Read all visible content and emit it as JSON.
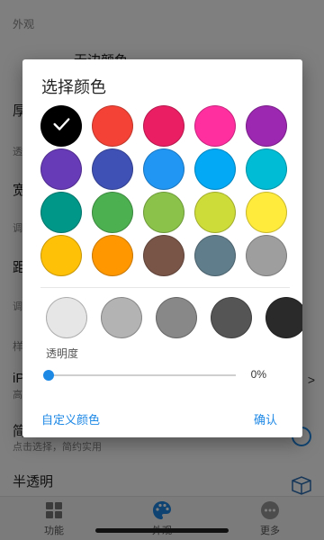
{
  "background": {
    "section_appearance": "外观",
    "rows": [
      {
        "title": "无边颜色",
        "sub": ""
      },
      {
        "title": "厚",
        "sub": "透"
      },
      {
        "title": "宽",
        "sub": "调"
      },
      {
        "title": "距",
        "sub": "调"
      },
      {
        "title": "样",
        "sub": ""
      },
      {
        "title": "iP",
        "sub": "高"
      },
      {
        "title": "简",
        "sub": "点击选择，简约实用"
      },
      {
        "title": "半透明",
        "sub": ""
      }
    ],
    "nav": [
      {
        "label": "功能",
        "icon": "grid-icon"
      },
      {
        "label": "外观",
        "icon": "palette-icon"
      },
      {
        "label": "更多",
        "icon": "more-icon"
      }
    ]
  },
  "dialog": {
    "title": "选择颜色",
    "colors": [
      "#000000",
      "#f44336",
      "#e91e63",
      "#ff2fa0",
      "#9c27b0",
      "#673ab7",
      "#3f51b5",
      "#2196f3",
      "#03a9f4",
      "#00bcd4",
      "#009688",
      "#4caf50",
      "#8bc34a",
      "#cddc39",
      "#ffeb3b",
      "#ffc107",
      "#ff9800",
      "#795548",
      "#607d8b",
      "#9e9e9e"
    ],
    "selected_index": 0,
    "grays": [
      "#e6e6e6",
      "#b3b3b3",
      "#888888",
      "#555555",
      "#2a2a2a"
    ],
    "alpha_label": "透明度",
    "alpha_value": "0%",
    "alpha_fraction": 0.0,
    "custom_label": "自定义颜色",
    "confirm_label": "确认",
    "accent": "#1e88e5"
  }
}
